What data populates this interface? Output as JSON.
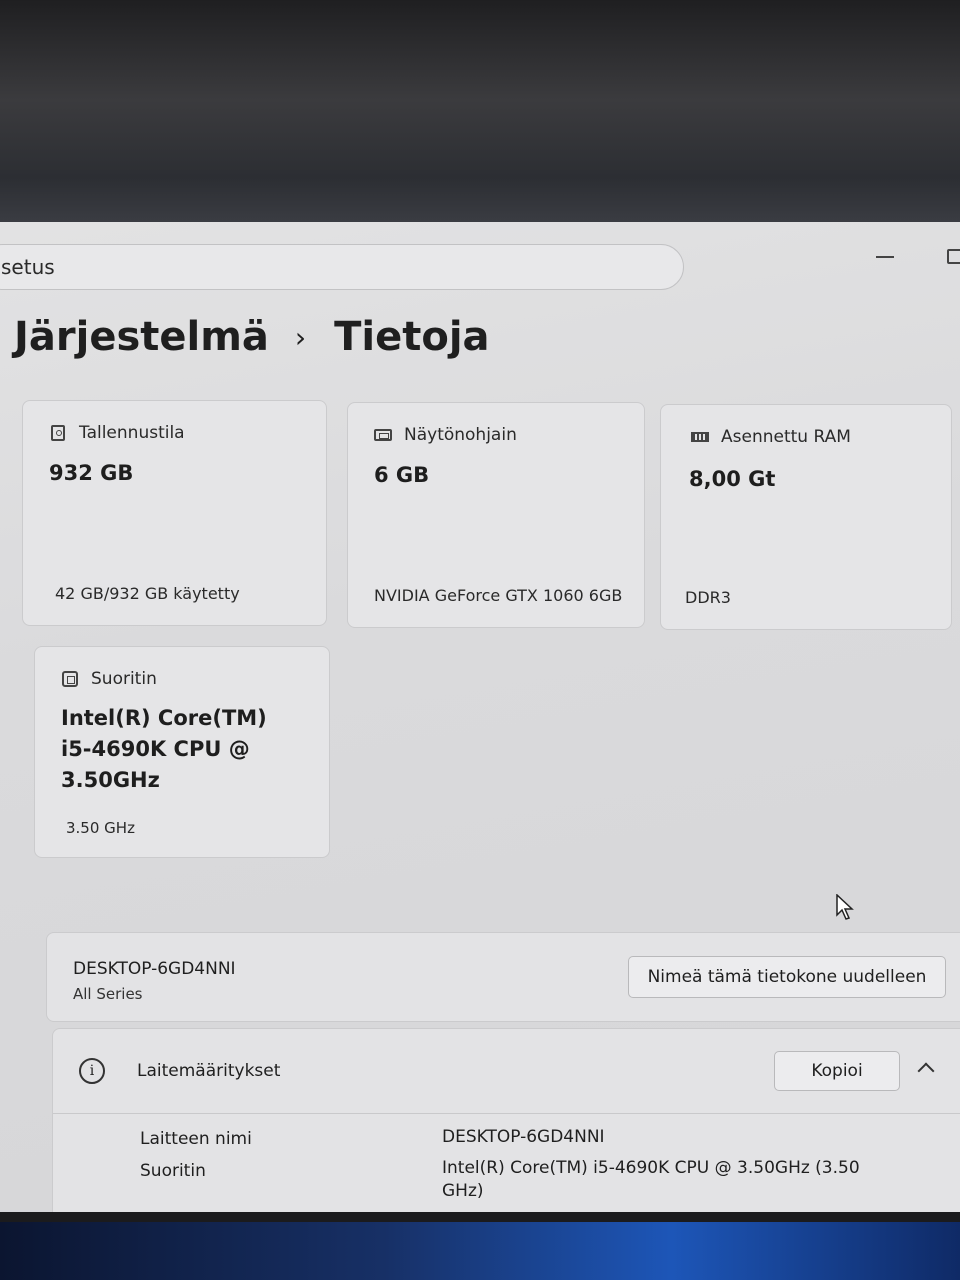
{
  "window": {
    "search_text": "setus"
  },
  "breadcrumb": {
    "parent": "Järjestelmä",
    "separator": "›",
    "current": "Tietoja"
  },
  "cards": {
    "storage": {
      "title": "Tallennustila",
      "value": "932 GB",
      "detail": "42 GB/932 GB käytetty"
    },
    "gpu": {
      "title": "Näytönohjain",
      "value": "6 GB",
      "detail": "NVIDIA GeForce GTX 1060 6GB"
    },
    "ram": {
      "title": "Asennettu RAM",
      "value": "8,00 Gt",
      "detail": "DDR3"
    },
    "cpu": {
      "title": "Suoritin",
      "value": "Intel(R) Core(TM)\ni5-4690K CPU @\n3.50GHz",
      "detail": "3.50 GHz"
    }
  },
  "device": {
    "name": "DESKTOP-6GD4NNI",
    "model": "All Series",
    "rename_label": "Nimeä tämä tietokone uudelleen"
  },
  "specs": {
    "title": "Laitemääritykset",
    "copy_label": "Kopioi",
    "rows": [
      {
        "label": "Laitteen nimi",
        "value": "DESKTOP-6GD4NNI"
      },
      {
        "label": "Suoritin",
        "value": "Intel(R) Core(TM) i5-4690K CPU @ 3.50GHz (3.50 GHz)"
      }
    ]
  }
}
